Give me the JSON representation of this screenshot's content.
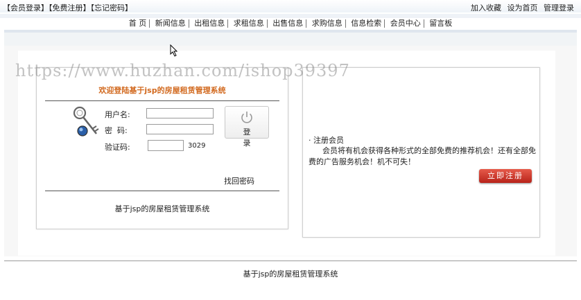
{
  "topbar": {
    "left_links": [
      "【会员登录】",
      "【免费注册】",
      "【忘记密码】"
    ],
    "right_links": [
      "加入收藏",
      "设为首页",
      "管理登录"
    ]
  },
  "nav": {
    "items": [
      "首 页",
      "新闻信息",
      "出租信息",
      "求租信息",
      "出售信息",
      "求购信息",
      "信息检索",
      "会员中心",
      "留言板"
    ]
  },
  "watermark": "https://www.huzhan.com/ishop39397",
  "login": {
    "title": "欢迎登陆基于jsp的房屋租赁管理系统",
    "username_label": "用户名:",
    "password_label": "密  码:",
    "captcha_label": "验证码:",
    "username_value": "",
    "password_value": "",
    "captcha_value": "",
    "captcha_code": "3029",
    "login_button": "登录",
    "find_password": "找回密码",
    "system_name": "基于jsp的房屋租赁管理系统"
  },
  "register": {
    "heading": "· 注册会员",
    "text": "会员将有机会获得各种形式的全部免费的推荐机会！还有全部免费的广告服务机会！机不可失！",
    "button": "立即注册"
  },
  "footer": {
    "text": "基于jsp的房屋租赁管理系统"
  },
  "colors": {
    "title_orange": "#d2691e",
    "register_red": "#c0392b"
  }
}
